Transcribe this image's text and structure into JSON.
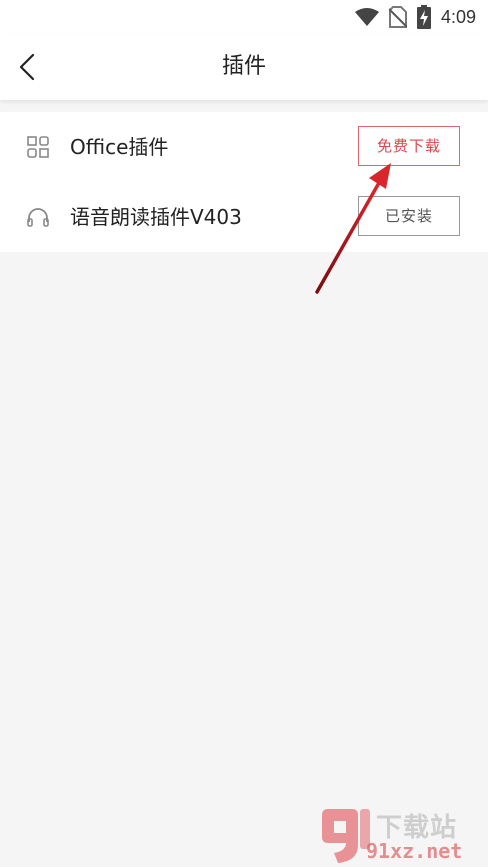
{
  "status_bar": {
    "time": "4:09",
    "icons": [
      "wifi-icon",
      "no-sim-icon",
      "battery-charging-icon"
    ]
  },
  "header": {
    "title": "插件",
    "back_icon": "chevron-left-icon"
  },
  "plugins": [
    {
      "name": "Office插件",
      "icon": "office-grid-icon",
      "button_label": "免费下载",
      "state": "download"
    },
    {
      "name": "语音朗读插件V403",
      "icon": "headphones-icon",
      "button_label": "已安装",
      "state": "installed"
    }
  ],
  "colors": {
    "accent": "#d9484c",
    "arrow": "#c4161c",
    "background": "#f5f5f5"
  },
  "watermark": {
    "logo_text": "下载站",
    "url": "91xz.net"
  }
}
